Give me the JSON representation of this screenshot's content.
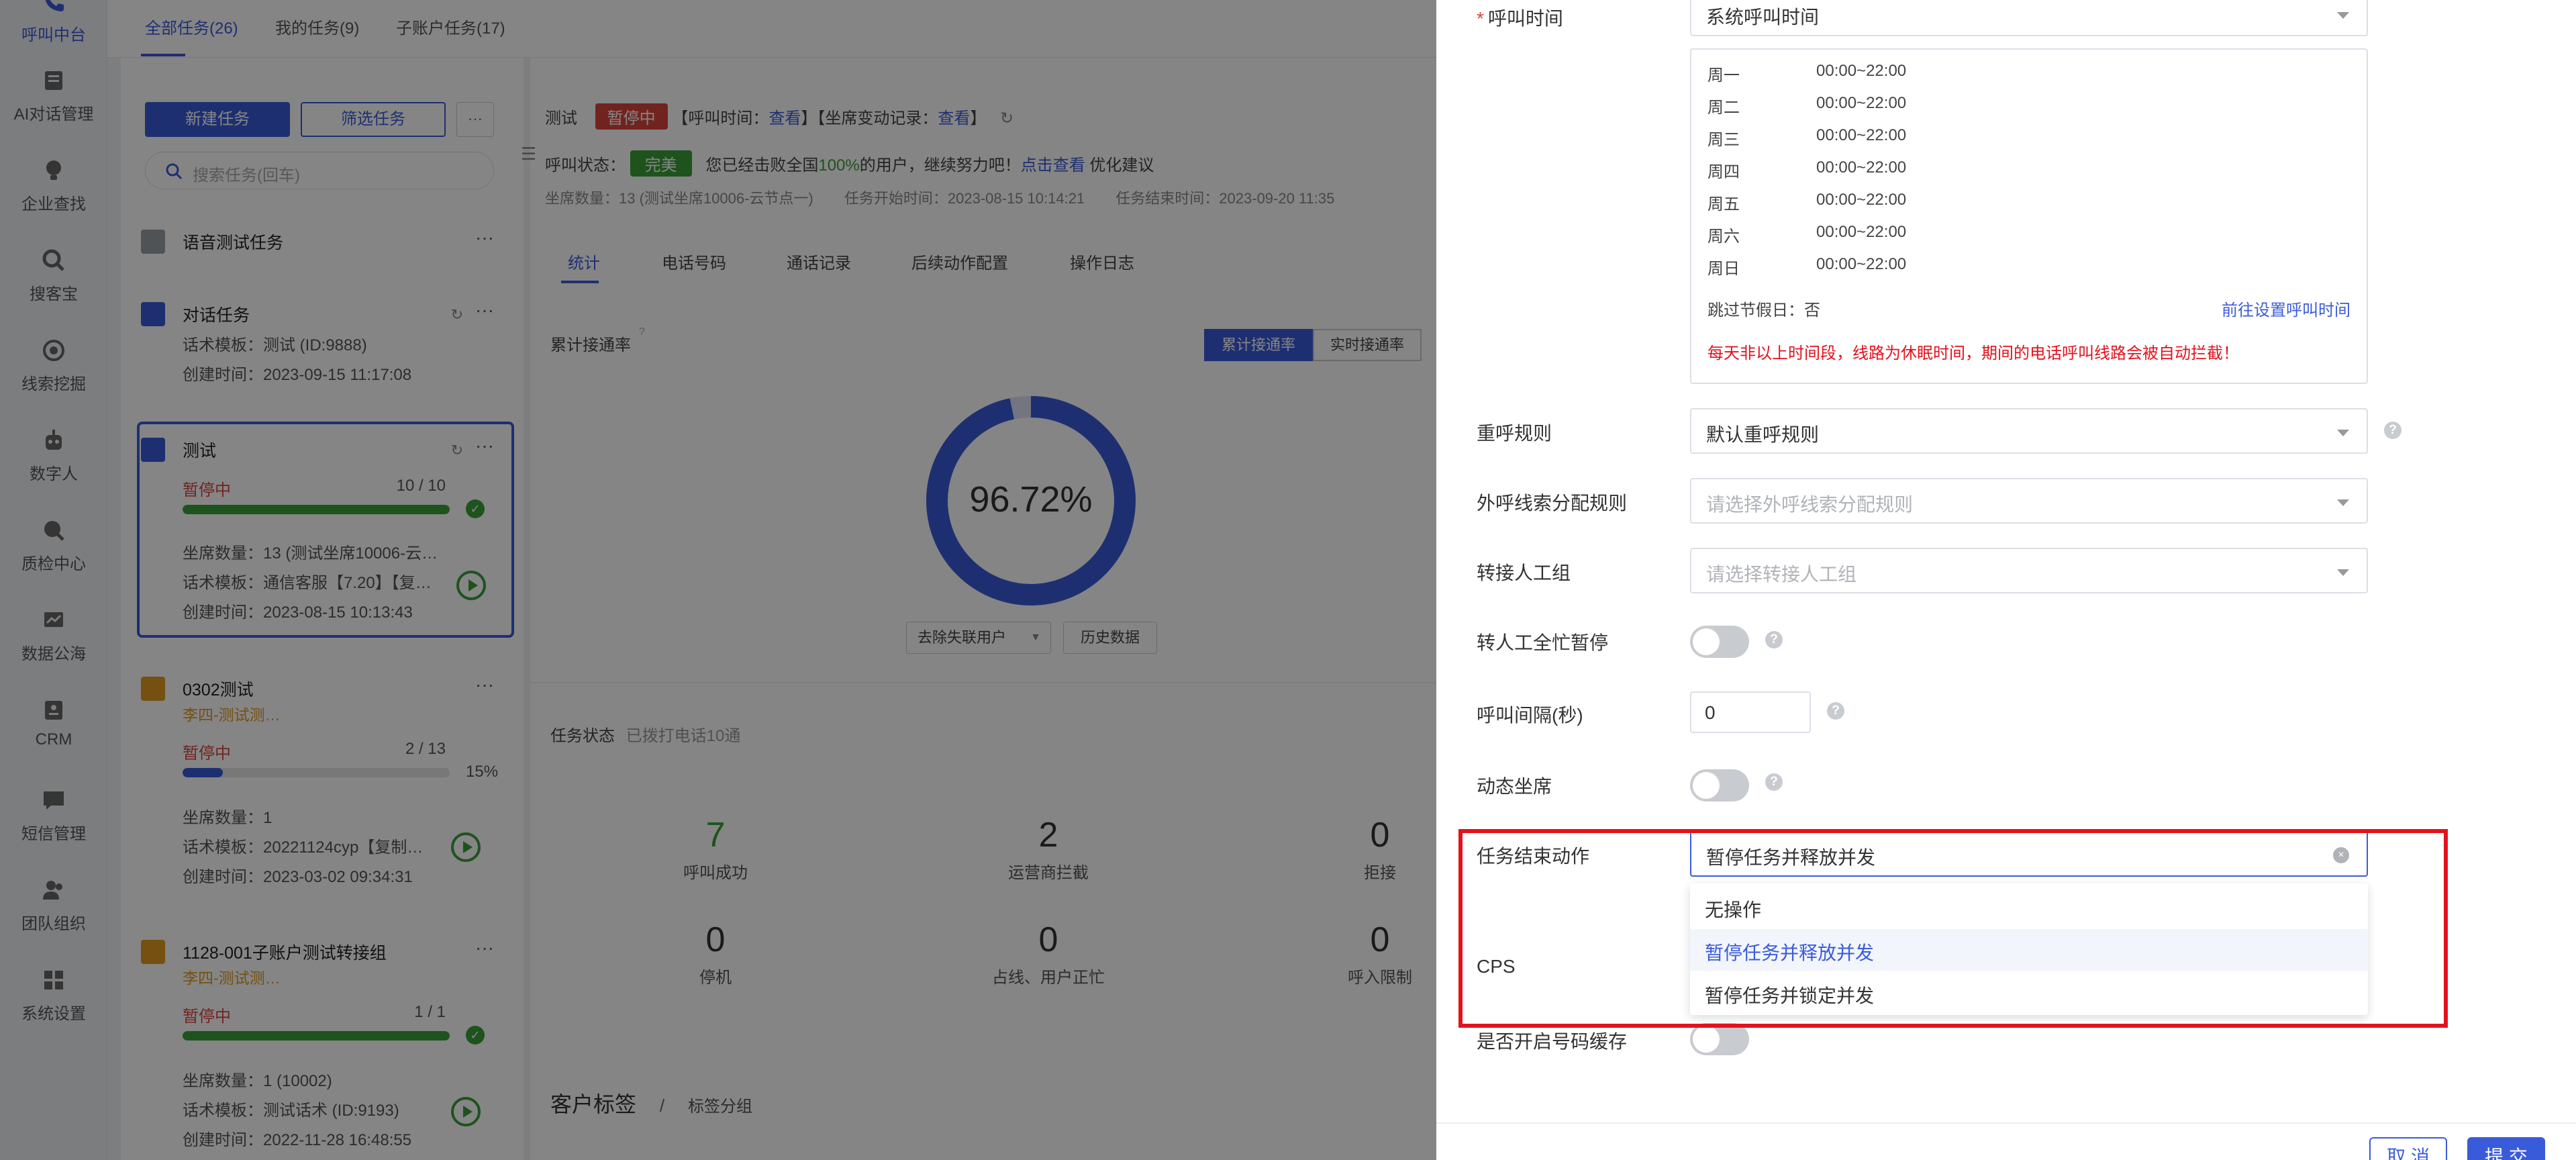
{
  "nav": {
    "items": [
      {
        "label": "呼叫中台",
        "icon": "phone-icon"
      },
      {
        "label": "AI对话管理",
        "icon": "ai-chat-icon"
      },
      {
        "label": "企业查找",
        "icon": "bulb-icon"
      },
      {
        "label": "搜客宝",
        "icon": "search-icon"
      },
      {
        "label": "线索挖掘",
        "icon": "target-icon"
      },
      {
        "label": "数字人",
        "icon": "robot-icon"
      },
      {
        "label": "质检中心",
        "icon": "inspect-icon"
      },
      {
        "label": "数据公海",
        "icon": "data-icon"
      },
      {
        "label": "CRM",
        "icon": "crm-icon"
      },
      {
        "label": "短信管理",
        "icon": "sms-icon"
      },
      {
        "label": "团队组织",
        "icon": "team-icon"
      },
      {
        "label": "系统设置",
        "icon": "grid-icon"
      }
    ]
  },
  "top_tabs": [
    "全部任务(26)",
    "我的任务(9)",
    "子账户任务(17)"
  ],
  "list": {
    "new_button": "新建任务",
    "filter_button": "筛选任务",
    "more": "···",
    "search_placeholder": "搜索任务(回车)",
    "group_title": "语音测试任务",
    "tasks": [
      {
        "title": "对话任务",
        "line1": "话术模板：测试 (ID:9888)",
        "line2": "创建时间：2023-09-15 11:17:08"
      },
      {
        "title": "测试",
        "status": "暂停中",
        "count": "10 / 10",
        "progress": 1.0,
        "line1": "坐席数量：13 (测试坐席10006-云…",
        "line2": "话术模板：通信客服【7.20】【复…",
        "line3": "创建时间：2023-08-15 10:13:43"
      },
      {
        "title": "0302测试",
        "sub": "李四-测试测…",
        "status": "暂停中",
        "count": "2 / 13",
        "pct": "15%",
        "progress": 0.15,
        "line1": "坐席数量：1",
        "line2": "话术模板：20221124cyp【复制…",
        "line3": "创建时间：2023-03-02 09:34:31"
      },
      {
        "title": "1128-001子账户测试转接组",
        "sub": "李四-测试测…",
        "status": "暂停中",
        "count": "1 / 1",
        "progress": 1.0,
        "line1": "坐席数量：1 (10002)",
        "line2": "话术模板：测试话术 (ID:9193)",
        "line3": "创建时间：2022-11-28 16:48:55"
      }
    ]
  },
  "detail": {
    "title": "测试",
    "status_tag": "暂停中",
    "call_time_prefix": "【呼叫时间：",
    "view": "查看",
    "seat_change_prefix": "】【坐席变动记录：",
    "bracket_close": "】",
    "call_status_label": "呼叫状态：",
    "call_status_tag": "完美",
    "call_status_msg_a": "您已经击败全国",
    "call_status_pct": "100%",
    "call_status_msg_b": "的用户，继续努力吧！",
    "call_status_link": "点击查看",
    "call_status_msg_c": "优化建议",
    "seats": "坐席数量：13 (测试坐席10006-云节点一)",
    "start_time": "任务开始时间：2023-08-15 10:14:21",
    "end_time": "任务结束时间：2023-09-20 11:35",
    "subtabs": [
      "统计",
      "电话号码",
      "通话记录",
      "后续动作配置",
      "操作日志"
    ],
    "rate_title": "累计接通率",
    "seg_a": "累计接通率",
    "seg_b": "实时接通率",
    "donut_value": 96.72,
    "donut_label": "96.72%",
    "dropdown_label": "去除失联用户",
    "history_button": "历史数据",
    "task_status_label": "任务状态",
    "task_status_note": "已拨打电话10通",
    "stats": [
      {
        "n": "7",
        "l": "呼叫成功"
      },
      {
        "n": "2",
        "l": "运营商拦截"
      },
      {
        "n": "0",
        "l": "拒接"
      },
      {
        "n": "0",
        "l": "停机"
      },
      {
        "n": "0",
        "l": "占线、用户正忙"
      },
      {
        "n": "0",
        "l": "呼入限制"
      }
    ],
    "tag_section": "客户标签",
    "tag_sep": "/",
    "tag_group": "标签分组"
  },
  "drawer": {
    "call_time_label": "呼叫时间",
    "call_time_value": "系统呼叫时间",
    "schedule": [
      {
        "day": "周一",
        "time": "00:00~22:00"
      },
      {
        "day": "周二",
        "time": "00:00~22:00"
      },
      {
        "day": "周三",
        "time": "00:00~22:00"
      },
      {
        "day": "周四",
        "time": "00:00~22:00"
      },
      {
        "day": "周五",
        "time": "00:00~22:00"
      },
      {
        "day": "周六",
        "time": "00:00~22:00"
      },
      {
        "day": "周日",
        "time": "00:00~22:00"
      }
    ],
    "skip_holiday": "跳过节假日：否",
    "goto_setting": "前往设置呼叫时间",
    "warning": "每天非以上时间段，线路为休眠时间，期间的电话呼叫线路会被自动拦截！",
    "redial_label": "重呼规则",
    "redial_value": "默认重呼规则",
    "outbound_label": "外呼线索分配规则",
    "outbound_placeholder": "请选择外呼线索分配规则",
    "transfer_label": "转接人工组",
    "transfer_placeholder": "请选择转接人工组",
    "busy_pause_label": "转人工全忙暂停",
    "interval_label": "呼叫间隔(秒)",
    "interval_value": "0",
    "dynamic_seat_label": "动态坐席",
    "end_action_label": "任务结束动作",
    "end_action_value": "暂停任务并释放并发",
    "end_action_options": [
      "无操作",
      "暂停任务并释放并发",
      "暂停任务并锁定并发"
    ],
    "cps_label": "CPS",
    "cache_label": "是否开启号码缓存",
    "cancel": "取 消",
    "submit": "提 交"
  },
  "colors": {
    "accent": "#3a5bd9",
    "danger": "#d9453d",
    "success": "#3aa03a",
    "highlight": "#e3121c"
  }
}
